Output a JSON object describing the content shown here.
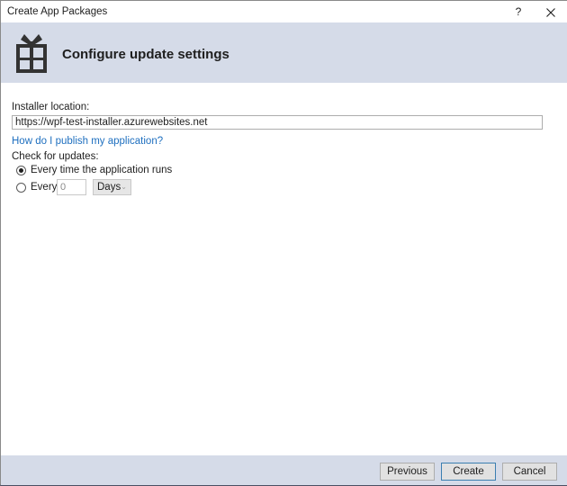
{
  "window": {
    "title": "Create App Packages",
    "help_label": "?",
    "close_label": "✕"
  },
  "header": {
    "icon": "gift-package-icon",
    "title": "Configure update settings"
  },
  "form": {
    "installer_label": "Installer location:",
    "installer_value": "https://wpf-test-installer.azurewebsites.net",
    "help_link": "How do I publish my application?",
    "check_label": "Check for updates:",
    "options": [
      {
        "label": "Every time the application runs",
        "checked": true
      },
      {
        "label": "Every",
        "checked": false
      }
    ],
    "interval_value": "0",
    "interval_unit": "Days"
  },
  "footer": {
    "previous_label": "Previous",
    "create_label": "Create",
    "cancel_label": "Cancel"
  },
  "colors": {
    "header_bg": "#d5dbe8",
    "link": "#1e6fbf",
    "default_button_border": "#3c7fb1"
  }
}
